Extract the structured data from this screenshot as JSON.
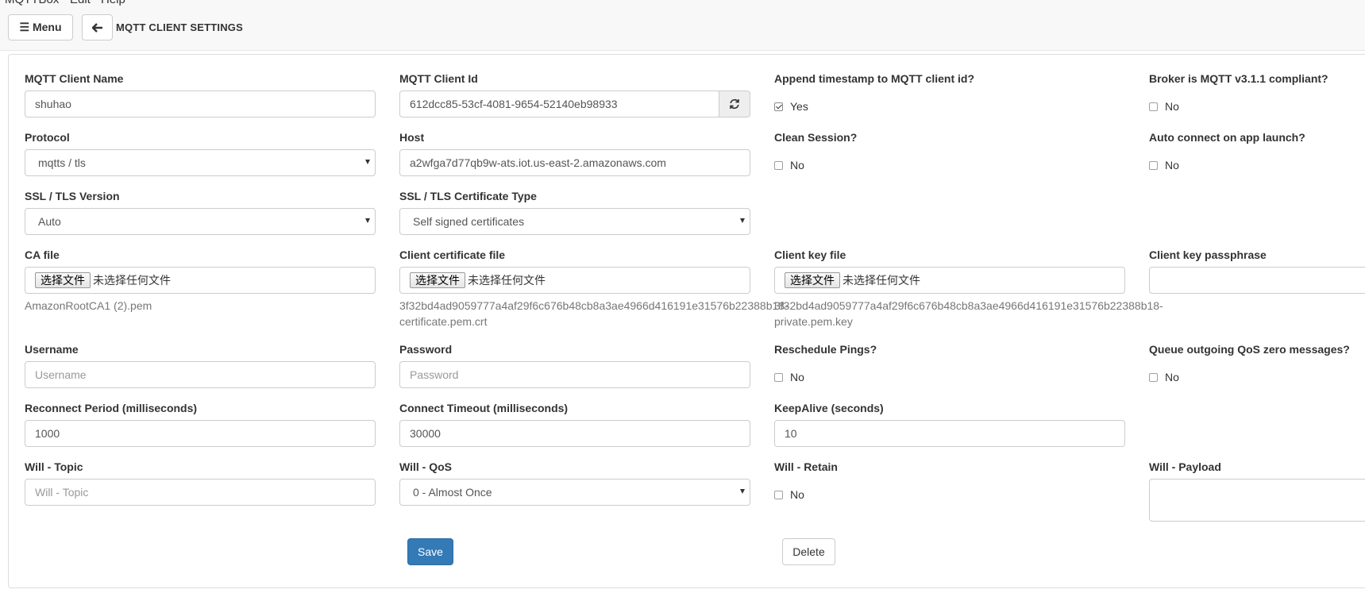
{
  "app_menu": [
    "MQTTBox",
    "Edit",
    "Help"
  ],
  "toolbar": {
    "menu_label": "☰ Menu",
    "back_symbol": "🡐",
    "title": "MQTT CLIENT SETTINGS"
  },
  "form": {
    "client_name": {
      "label": "MQTT Client Name",
      "value": "shuhao"
    },
    "client_id": {
      "label": "MQTT Client Id",
      "value": "612dcc85-53cf-4081-9654-52140eb98933"
    },
    "append_timestamp": {
      "label": "Append timestamp to MQTT client id?",
      "option": "Yes",
      "checked": true
    },
    "broker_compliant": {
      "label": "Broker is MQTT v3.1.1 compliant?",
      "option": "No",
      "checked": false
    },
    "protocol": {
      "label": "Protocol",
      "value": "mqtts / tls"
    },
    "host": {
      "label": "Host",
      "value": "a2wfga7d77qb9w-ats.iot.us-east-2.amazonaws.com"
    },
    "clean_session": {
      "label": "Clean Session?",
      "option": "No",
      "checked": false
    },
    "auto_connect": {
      "label": "Auto connect on app launch?",
      "option": "No",
      "checked": false
    },
    "ssl_version": {
      "label": "SSL / TLS Version",
      "value": "Auto"
    },
    "cert_type": {
      "label": "SSL / TLS Certificate Type",
      "value": "Self signed certificates"
    },
    "ca_file": {
      "label": "CA file",
      "button": "选择文件",
      "status": "未选择任何文件",
      "filename": "AmazonRootCA1 (2).pem"
    },
    "client_cert": {
      "label": "Client certificate file",
      "button": "选择文件",
      "status": "未选择任何文件",
      "filename_line1": "3f32bd4ad9059777a4af29f6c676b48cb8a3ae4966d416191e31576b22388b18-",
      "filename_line2": "certificate.pem.crt"
    },
    "client_key": {
      "label": "Client key file",
      "button": "选择文件",
      "status": "未选择任何文件",
      "filename_line1": "3f32bd4ad9059777a4af29f6c676b48cb8a3ae4966d416191e31576b22388b18-",
      "filename_line2": "private.pem.key"
    },
    "key_passphrase": {
      "label": "Client key passphrase",
      "value": ""
    },
    "username": {
      "label": "Username",
      "placeholder": "Username"
    },
    "password": {
      "label": "Password",
      "placeholder": "Password"
    },
    "reschedule_pings": {
      "label": "Reschedule Pings?",
      "option": "No",
      "checked": false
    },
    "queue_qos_zero": {
      "label": "Queue outgoing QoS zero messages?",
      "option": "No",
      "checked": false
    },
    "reconnect_period": {
      "label": "Reconnect Period (milliseconds)",
      "value": "1000"
    },
    "connect_timeout": {
      "label": "Connect Timeout (milliseconds)",
      "value": "30000"
    },
    "keepalive": {
      "label": "KeepAlive (seconds)",
      "value": "10"
    },
    "will_topic": {
      "label": "Will - Topic",
      "placeholder": "Will - Topic"
    },
    "will_qos": {
      "label": "Will - QoS",
      "value": "0 - Almost Once"
    },
    "will_retain": {
      "label": "Will - Retain",
      "option": "No",
      "checked": false
    },
    "will_payload": {
      "label": "Will - Payload",
      "value": ""
    }
  },
  "actions": {
    "save": "Save",
    "delete": "Delete"
  }
}
